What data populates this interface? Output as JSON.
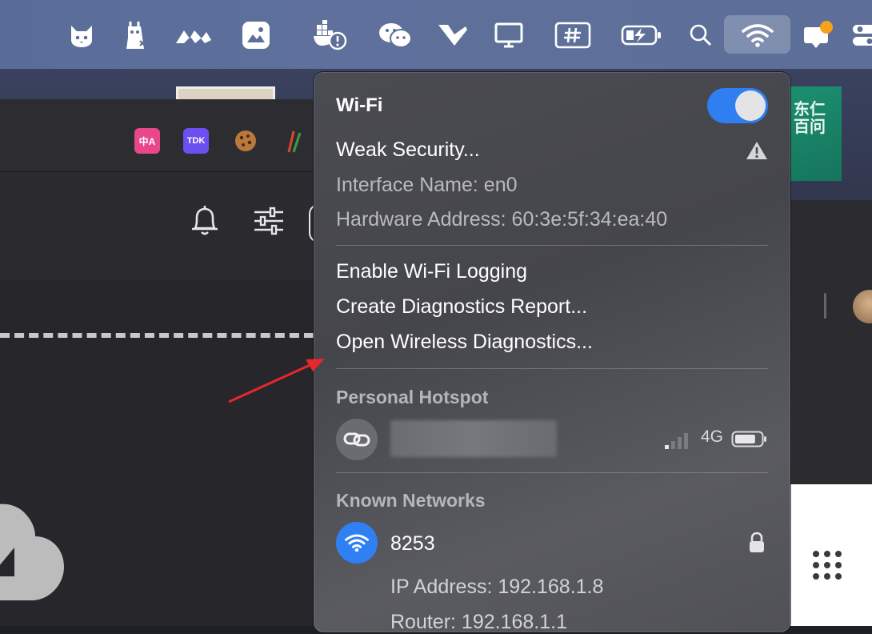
{
  "menubar": {
    "icons": [
      "cat-icon",
      "alpaca-icon",
      "mountain-logo-icon",
      "photo-icon",
      "docker-alert-icon",
      "wechat-icon",
      "paper-plane-icon",
      "display-icon",
      "hash-icon",
      "battery-charging-icon",
      "search-icon",
      "wifi-icon",
      "notification-icon",
      "control-center-icon"
    ]
  },
  "browser": {
    "extensions": [
      {
        "label": "中A",
        "color": "#e8488b"
      },
      {
        "label": "TDK",
        "color": "#6b4ff0"
      },
      {
        "label": "🍪",
        "color": "transparent"
      },
      {
        "label": "🥢",
        "color": "transparent"
      }
    ]
  },
  "book": {
    "text": "东仁\n百问百答"
  },
  "wifi_menu": {
    "title": "Wi-Fi",
    "toggle_on": true,
    "weak_security": "Weak Security...",
    "interface_name": "Interface Name: en0",
    "hardware_address": "Hardware Address: 60:3e:5f:34:ea:40",
    "actions": [
      "Enable Wi-Fi Logging",
      "Create Diagnostics Report...",
      "Open Wireless Diagnostics..."
    ],
    "hotspot_section": "Personal Hotspot",
    "hotspot": {
      "network_type": "4G",
      "battery_level_fraction": 0.8
    },
    "known_section": "Known Networks",
    "known_network": {
      "name": "8253",
      "ip": "IP Address: 192.168.1.8",
      "router": "Router: 192.168.1.1"
    }
  },
  "colors": {
    "menubar": "#5d6f99",
    "toggle_on": "#2f7ef2",
    "wifi_circle": "#2f80f3",
    "notification_dot": "#f7a21b",
    "annotation_arrow": "#e8262b"
  }
}
